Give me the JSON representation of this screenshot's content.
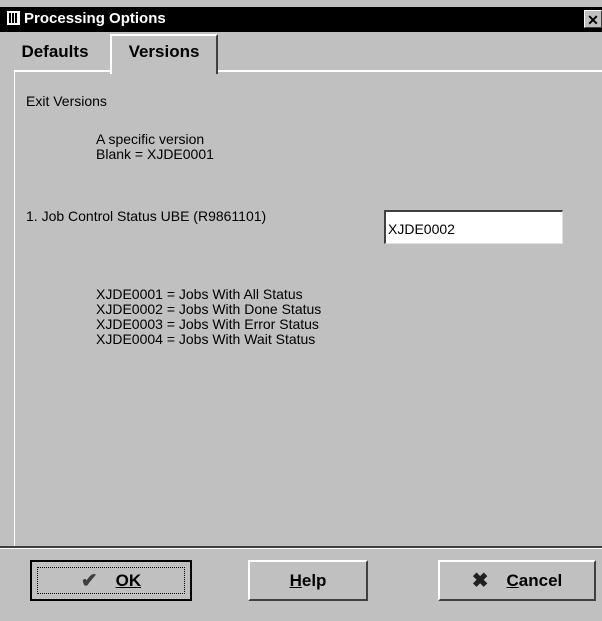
{
  "window": {
    "title": "Processing Options",
    "close_glyph": "✕",
    "icon": "form-icon"
  },
  "tabs": [
    {
      "label": "Defaults",
      "active": false
    },
    {
      "label": "Versions",
      "active": true
    }
  ],
  "panel": {
    "section_title": "Exit Versions",
    "help_line1": "A specific version",
    "help_line2": "Blank = XJDE0001",
    "field_label": "1. Job Control Status UBE (R9861101)",
    "field_value": "XJDE0002",
    "versions_list": [
      "XJDE0001 = Jobs With All Status",
      "XJDE0002 = Jobs With Done Status",
      "XJDE0003 = Jobs With Error Status",
      "XJDE0004 = Jobs With Wait Status"
    ]
  },
  "buttons": {
    "ok_label": "OK",
    "ok_icon": "checkmark-icon",
    "help_label": "Help",
    "cancel_label": "Cancel",
    "cancel_icon": "x-icon"
  },
  "colors": {
    "titlebar": "#000000",
    "dialog": "#c0c0c0"
  }
}
